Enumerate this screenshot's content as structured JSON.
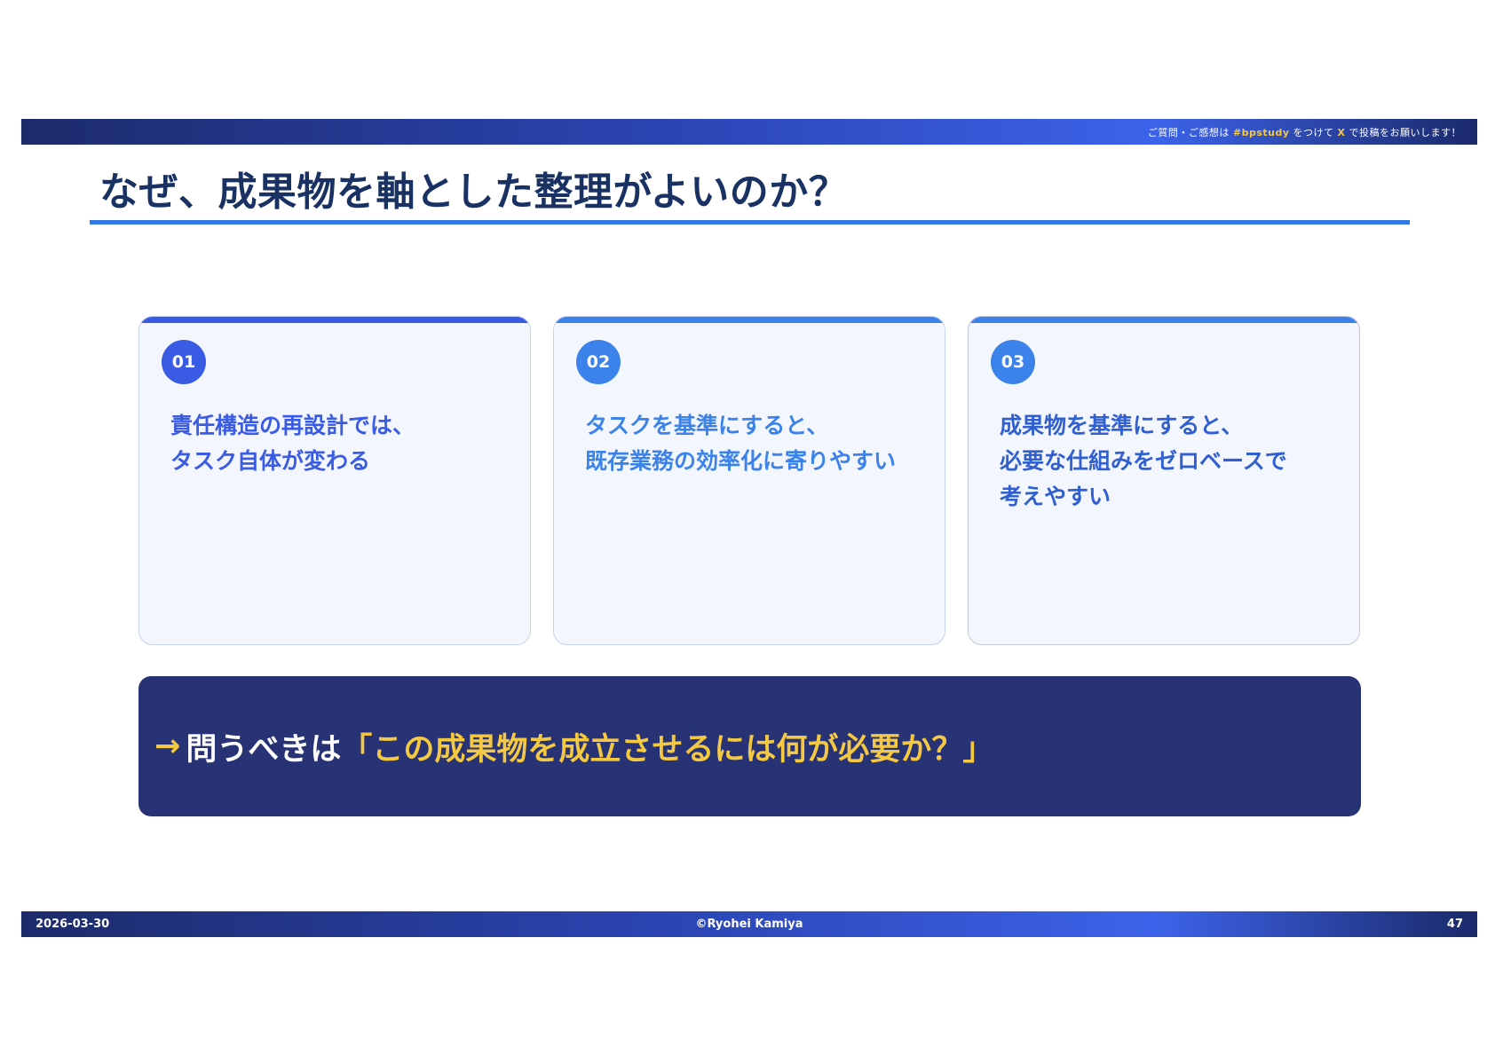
{
  "header_bar": {
    "prefix": "ご質問・ご感想は",
    "hashtag": "#bpstudy",
    "middle": "をつけて",
    "platform": "X",
    "suffix": "で投稿をお願いします！"
  },
  "title": "なぜ、成果物を軸とした整理がよいのか？",
  "cards": [
    {
      "number": "01",
      "lines": [
        "責任構造の再設計では、",
        "タスク自体が変わる"
      ],
      "accent_color": "#3a5be3",
      "text_color": "#3a5be3"
    },
    {
      "number": "02",
      "lines": [
        "タスクを基準にすると、",
        "既存業務の効率化に寄りやすい"
      ],
      "accent_color": "#3b82ea",
      "text_color": "#3b82ea"
    },
    {
      "number": "03",
      "lines": [
        "成果物を基準にすると、",
        "必要な仕組みをゼロベースで",
        "考えやすい"
      ],
      "accent_color": "#3b82ea",
      "text_color": "#2f5fd0"
    }
  ],
  "callout": {
    "arrow": "→",
    "lead": "問うべきは",
    "quote": "「この成果物を成立させるには何が必要か？」"
  },
  "footer": {
    "date": "2026-03-30",
    "copyright": "©Ryohei Kamiya",
    "page_number": "47"
  }
}
